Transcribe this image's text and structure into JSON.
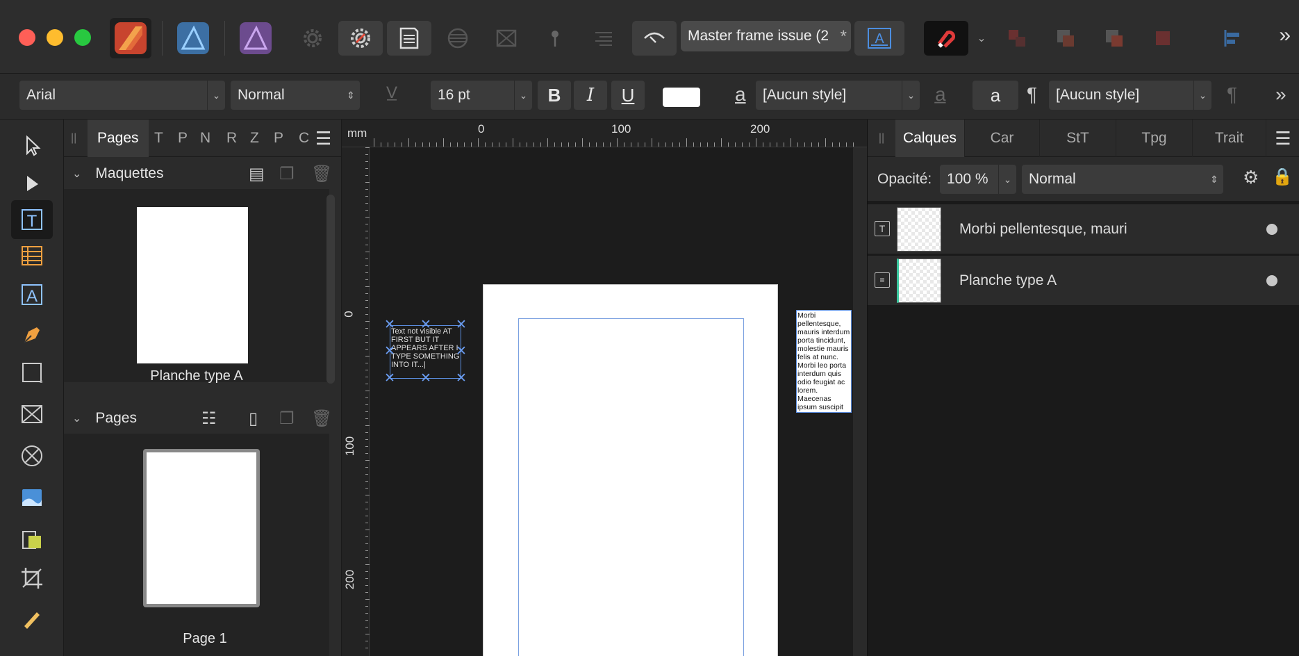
{
  "apps": {
    "publisher_icon": "affinity-publisher-icon",
    "designer_icon": "affinity-designer-icon",
    "photo_icon": "affinity-photo-icon"
  },
  "document": {
    "tab_title": "Master frame issue (2",
    "modified_mark": "*"
  },
  "context_bar": {
    "font_family": "Arial",
    "font_style": "Normal",
    "font_size": "16 pt",
    "bold": "B",
    "italic": "I",
    "underline": "U",
    "char_style_glyph": "a",
    "char_style": "[Aucun style]",
    "para_glyph": "a",
    "para_mark": "¶",
    "para_style": "[Aucun style]",
    "more": "»"
  },
  "top_more": "»",
  "pages_panel": {
    "tabs": [
      "Pages",
      "T",
      "P",
      "N",
      "R",
      "Z",
      "P",
      "C"
    ],
    "masters_title": "Maquettes",
    "master_label": "Planche type A",
    "pages_title": "Pages",
    "page_label": "Page 1"
  },
  "canvas": {
    "unit": "mm",
    "ruler_top": [
      "0",
      "100",
      "200"
    ],
    "ruler_left": [
      "0",
      "100",
      "200"
    ],
    "pasteboard_text": "Text not visible AT FIRST BUT IT APPEARS AFTER I TYPE SOMETHING INTO IT...|",
    "overflow_text": "Morbi pellentesque, mauris interdum porta tincidunt, molestie mauris felis at nunc. Morbi leo porta interdum quis odio feugiat ac lorem. Maecenas ipsum suscipit nisi quis dui quis arcu interdum. Proin vehicula mattis nisi at nisi scelerisque"
  },
  "layers_panel": {
    "tabs": [
      "Calques",
      "Car",
      "StT",
      "Tpg",
      "Trait"
    ],
    "opacity_label": "Opacité:",
    "opacity_value": "100 %",
    "blend_mode": "Normal",
    "layers": [
      {
        "name": "Morbi pellentesque, mauri",
        "type": "text-frame-icon"
      },
      {
        "name": "Planche type A",
        "type": "master-page-icon"
      }
    ]
  }
}
